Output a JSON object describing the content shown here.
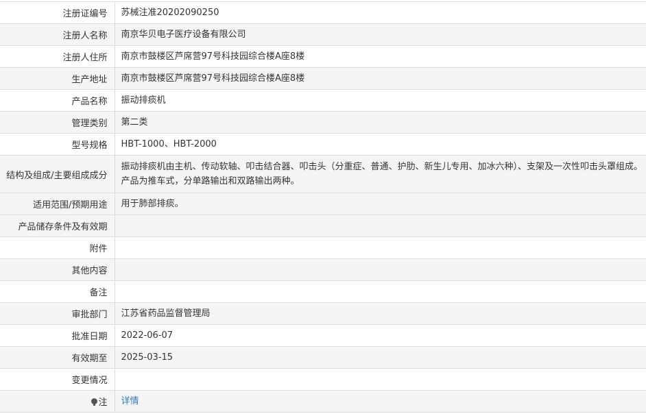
{
  "rows": [
    {
      "label": "注册证编号",
      "value": "苏械注准20202090250"
    },
    {
      "label": "注册人名称",
      "value": "南京华贝电子医疗设备有限公司"
    },
    {
      "label": "注册人住所",
      "value": "南京市鼓楼区芦席营97号科技园综合楼A座8楼"
    },
    {
      "label": "生产地址",
      "value": "南京市鼓楼区芦席营97号科技园综合楼A座8楼"
    },
    {
      "label": "产品名称",
      "value": "振动排痰机"
    },
    {
      "label": "管理类别",
      "value": "第二类"
    },
    {
      "label": "型号规格",
      "value": "HBT-1000、HBT-2000"
    },
    {
      "label": "结构及组成/主要组成成分",
      "value_line1": "振动排痰机由主机、传动软轴、叩击结合器、叩击头（分重症、普通、护肋、新生儿专用、加冰六种）、支架及一次性叩击头罩组成。",
      "value_line2": "产品为推车式，分单路输出和双路输出两种。"
    },
    {
      "label": "适用范围/预期用途",
      "value": "用于肺部排痰。"
    },
    {
      "label": "产品储存条件及有效期",
      "value": ""
    },
    {
      "label": "附件",
      "value": ""
    },
    {
      "label": "其他内容",
      "value": ""
    },
    {
      "label": "备注",
      "value": ""
    },
    {
      "label": "审批部门",
      "value": "江苏省药品监督管理局"
    },
    {
      "label": "批准日期",
      "value": "2022-06-07"
    },
    {
      "label": "有效期至",
      "value": "2025-03-15"
    },
    {
      "label": "变更情况",
      "value": ""
    },
    {
      "label": "注",
      "value": "详情",
      "icon": "lightbulb-icon"
    }
  ]
}
